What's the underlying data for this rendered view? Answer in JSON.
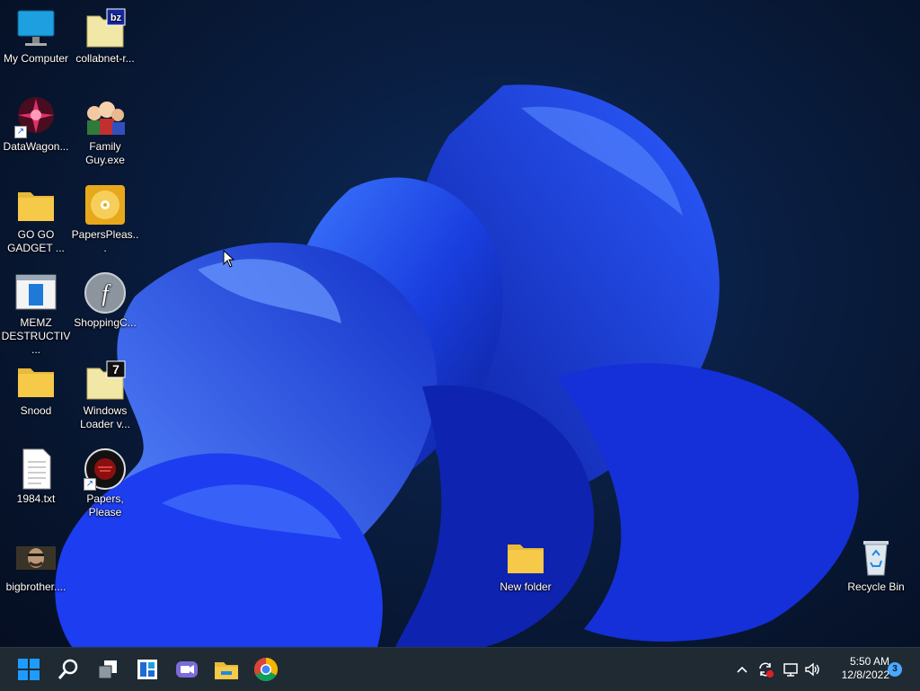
{
  "desktop": {
    "icons": [
      {
        "label": "My Computer",
        "icon": "computer-icon"
      },
      {
        "label": "collabnet-r...",
        "icon": "bz-file-icon"
      },
      {
        "label": "DataWagon...",
        "icon": "datawagon-icon"
      },
      {
        "label": "Family Guy.exe",
        "icon": "family-guy-icon"
      },
      {
        "label": "GO GO GADGET ...",
        "icon": "folder-icon"
      },
      {
        "label": "PapersPleas...",
        "icon": "disc-image-icon"
      },
      {
        "label": "MEMZ DESTRUCTIV...",
        "icon": "memz-window-icon"
      },
      {
        "label": "ShoppingC...",
        "icon": "flash-icon"
      },
      {
        "label": "Snood",
        "icon": "folder-icon"
      },
      {
        "label": "Windows Loader v...",
        "icon": "seven-zip-file-icon"
      },
      {
        "label": "1984.txt",
        "icon": "text-file-icon"
      },
      {
        "label": "Papers, Please",
        "icon": "papers-please-icon"
      },
      {
        "label": "bigbrother....",
        "icon": "image-file-icon"
      },
      {
        "label": "New folder",
        "icon": "folder-icon"
      },
      {
        "label": "Recycle Bin",
        "icon": "recycle-bin-icon"
      }
    ]
  },
  "taskbar": {
    "apps": [
      {
        "name": "Start",
        "icon": "windows-start-icon"
      },
      {
        "name": "Search",
        "icon": "search-icon"
      },
      {
        "name": "Task View",
        "icon": "task-view-icon"
      },
      {
        "name": "Widgets",
        "icon": "widgets-icon"
      },
      {
        "name": "Chat",
        "icon": "chat-icon"
      },
      {
        "name": "File Explorer",
        "icon": "file-explorer-icon"
      },
      {
        "name": "Google Chrome",
        "icon": "chrome-icon"
      }
    ],
    "tray": {
      "time": "5:50 AM",
      "date": "12/8/2022",
      "notification_count": "3"
    }
  },
  "colors": {
    "accent": "#1e6bff",
    "taskbar": "#1f2a33",
    "folder": "#f7c948"
  }
}
